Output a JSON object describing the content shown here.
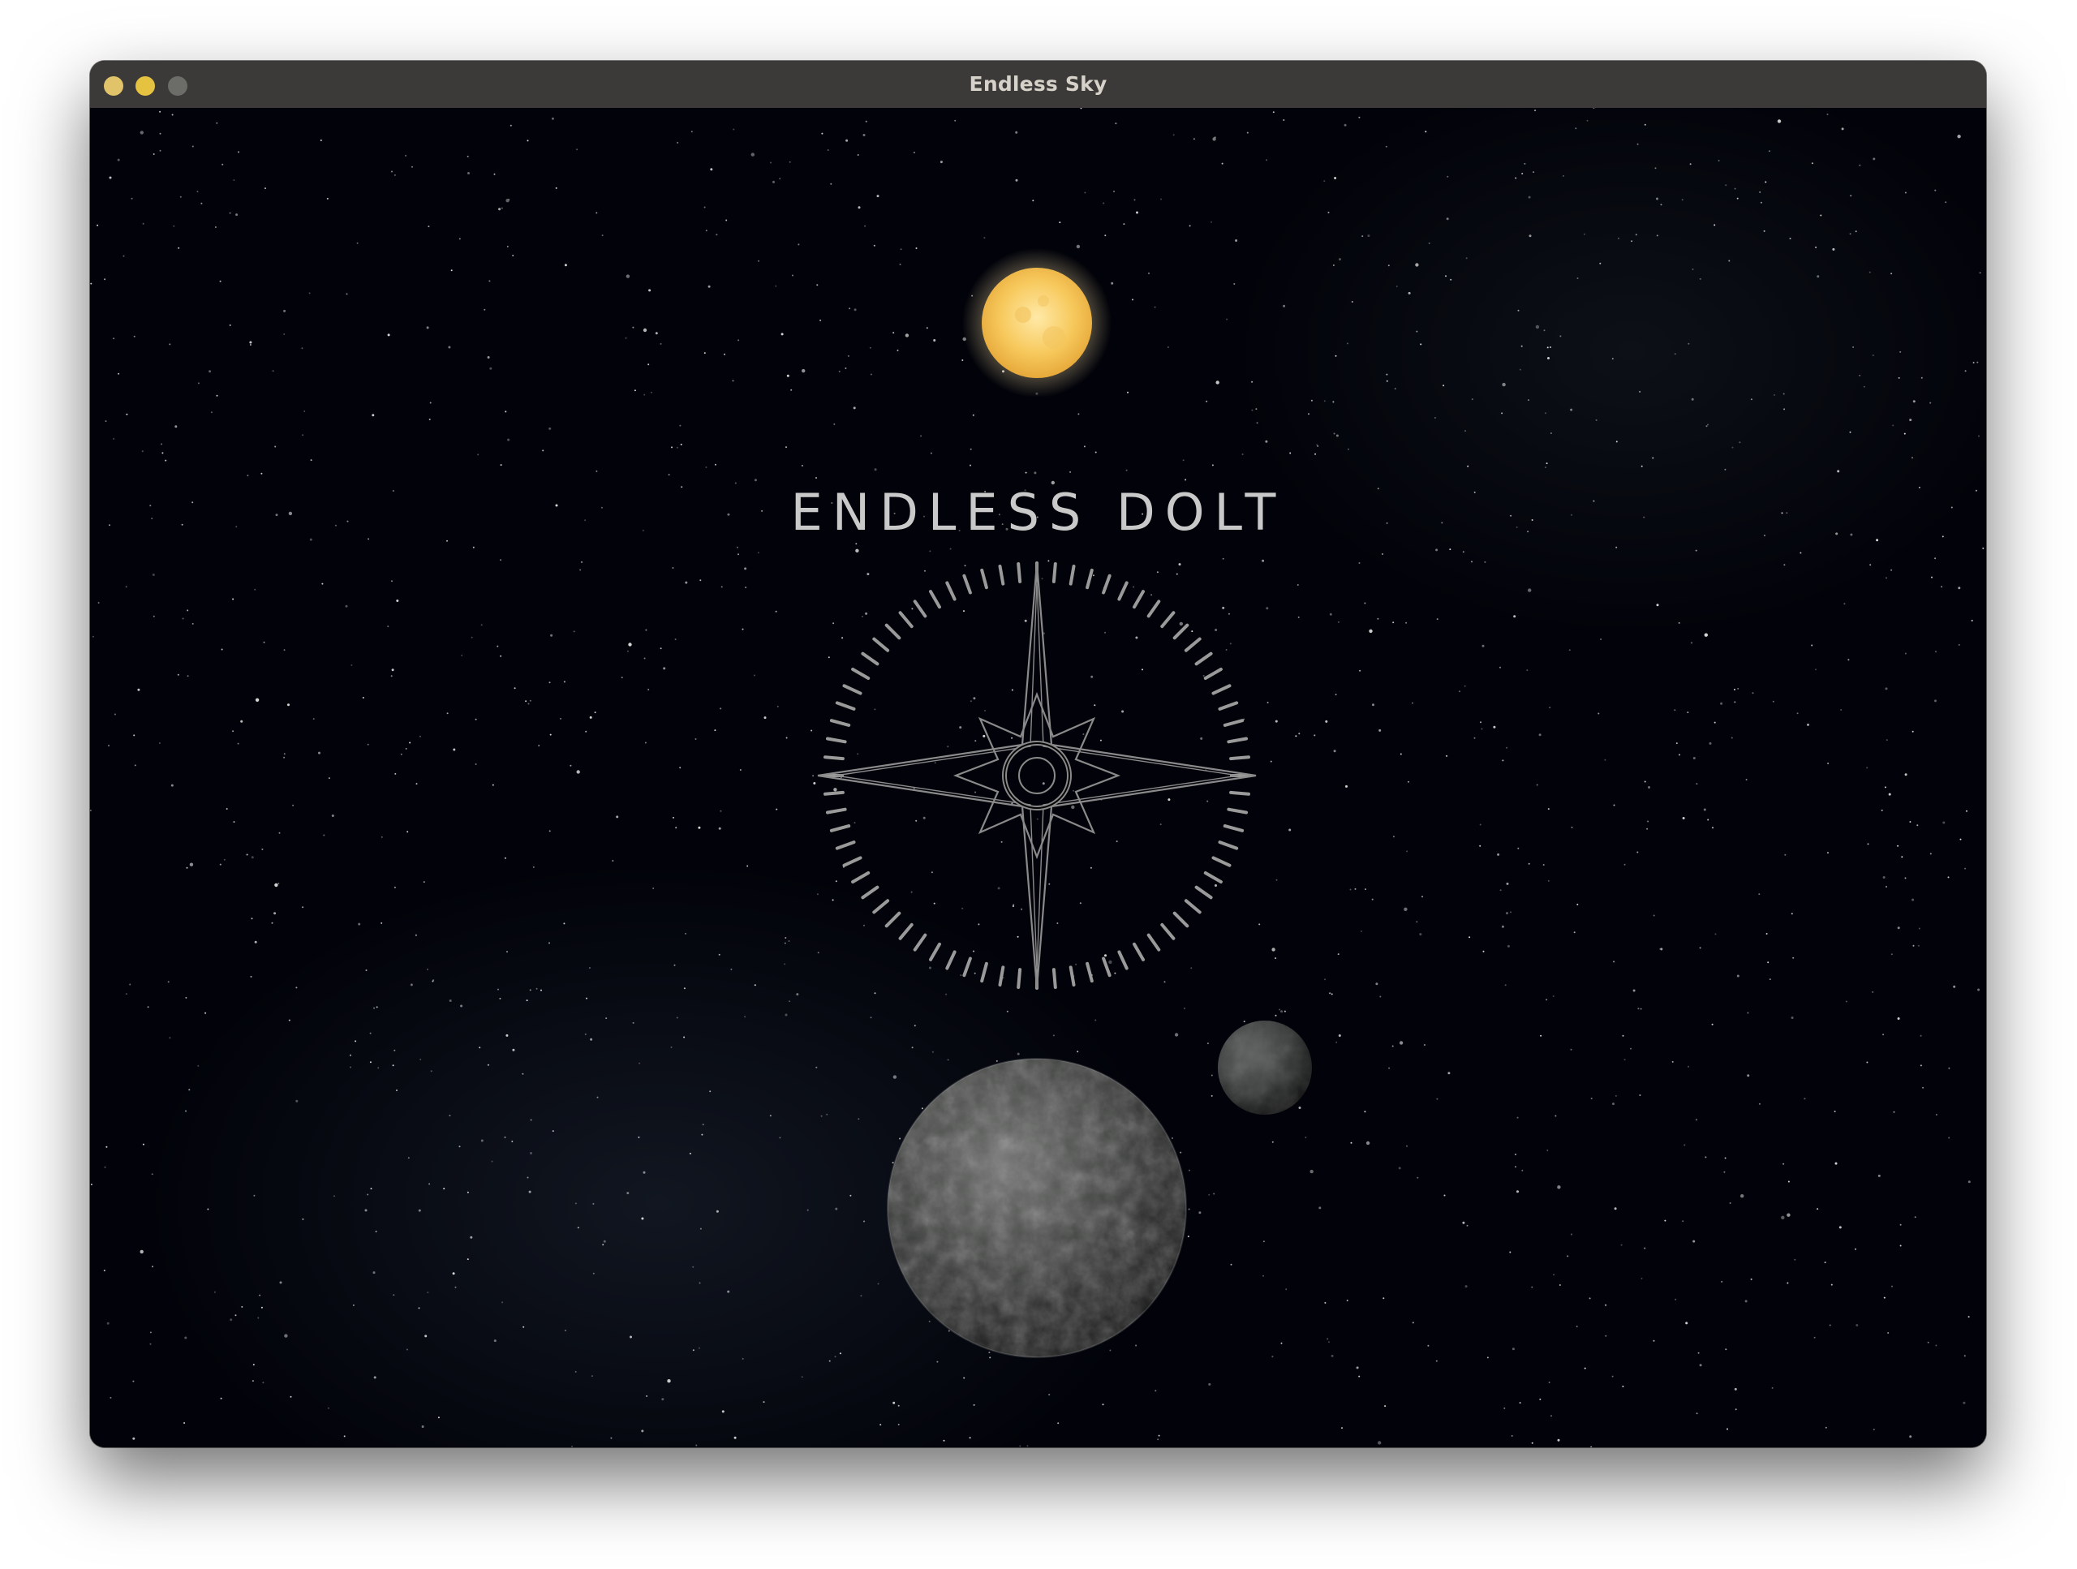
{
  "window": {
    "title": "Endless Sky"
  },
  "title_screen": {
    "logo_text": "ENDLESS DOLT"
  },
  "colors": {
    "sun": "#f6c96a",
    "space": "#02030a",
    "logo": "#b8b8b8"
  },
  "icons": {
    "close": "traffic-light-close",
    "minimize": "traffic-light-minimize",
    "zoom": "traffic-light-zoom"
  }
}
